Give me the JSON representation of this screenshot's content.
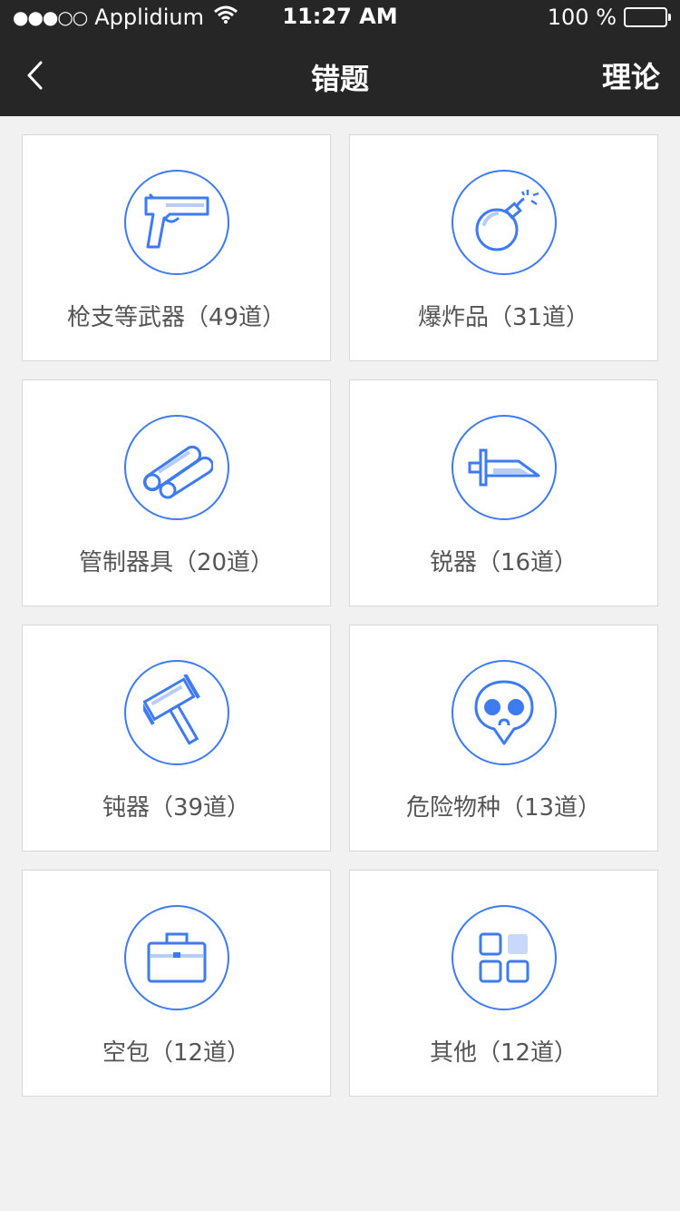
{
  "status_bar": {
    "signal": "●●●○○",
    "carrier": "Applidium",
    "time": "11:27 AM",
    "battery": "100 %"
  },
  "nav": {
    "title": "错题",
    "right_label": "理论"
  },
  "categories": [
    {
      "label": "枪支等武器（49道）",
      "icon": "gun-icon"
    },
    {
      "label": "爆炸品（31道）",
      "icon": "bomb-icon"
    },
    {
      "label": "管制器具（20道）",
      "icon": "pipes-icon"
    },
    {
      "label": "锐器（16道）",
      "icon": "knife-icon"
    },
    {
      "label": "钝器（39道）",
      "icon": "hammer-icon"
    },
    {
      "label": "危险物种（13道）",
      "icon": "skull-icon"
    },
    {
      "label": "空包（12道）",
      "icon": "briefcase-icon"
    },
    {
      "label": "其他（12道）",
      "icon": "grid-icon"
    }
  ],
  "colors": {
    "accent": "#3e7af0",
    "header_bg": "#262626",
    "page_bg": "#f1f1f1"
  }
}
